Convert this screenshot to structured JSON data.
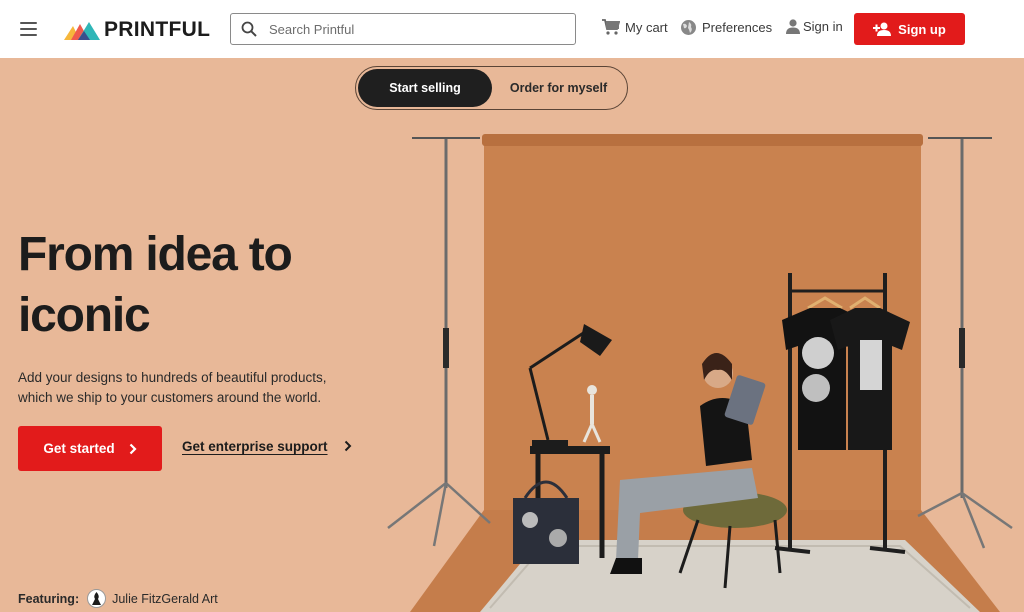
{
  "header": {
    "logo_text": "PRINTFUL",
    "search_placeholder": "Search Printful",
    "cart_label": "My cart",
    "preferences_label": "Preferences",
    "signin_label": "Sign in",
    "signup_label": "Sign up"
  },
  "toggle": {
    "options": [
      {
        "label": "Start selling",
        "active": true
      },
      {
        "label": "Order for myself",
        "active": false
      }
    ]
  },
  "hero": {
    "headline_line1": "From idea to",
    "headline_line2": "iconic",
    "subtext": "Add your designs to hundreds of beautiful products, which we ship to your customers around the world.",
    "cta_label": "Get started",
    "enterprise_label": "Get enterprise support",
    "featuring_label": "Featuring:",
    "featuring_name": "Julie FitzGerald Art"
  },
  "icons": {
    "menu": "hamburger-icon",
    "search": "search-icon",
    "cart": "cart-icon",
    "globe": "globe-icon",
    "user": "user-icon",
    "add_user": "add-user-icon",
    "chevron": "chevron-right-icon"
  },
  "colors": {
    "accent": "#e21b1b",
    "hero_bg": "#e8b898",
    "backdrop": "#c9824f"
  }
}
